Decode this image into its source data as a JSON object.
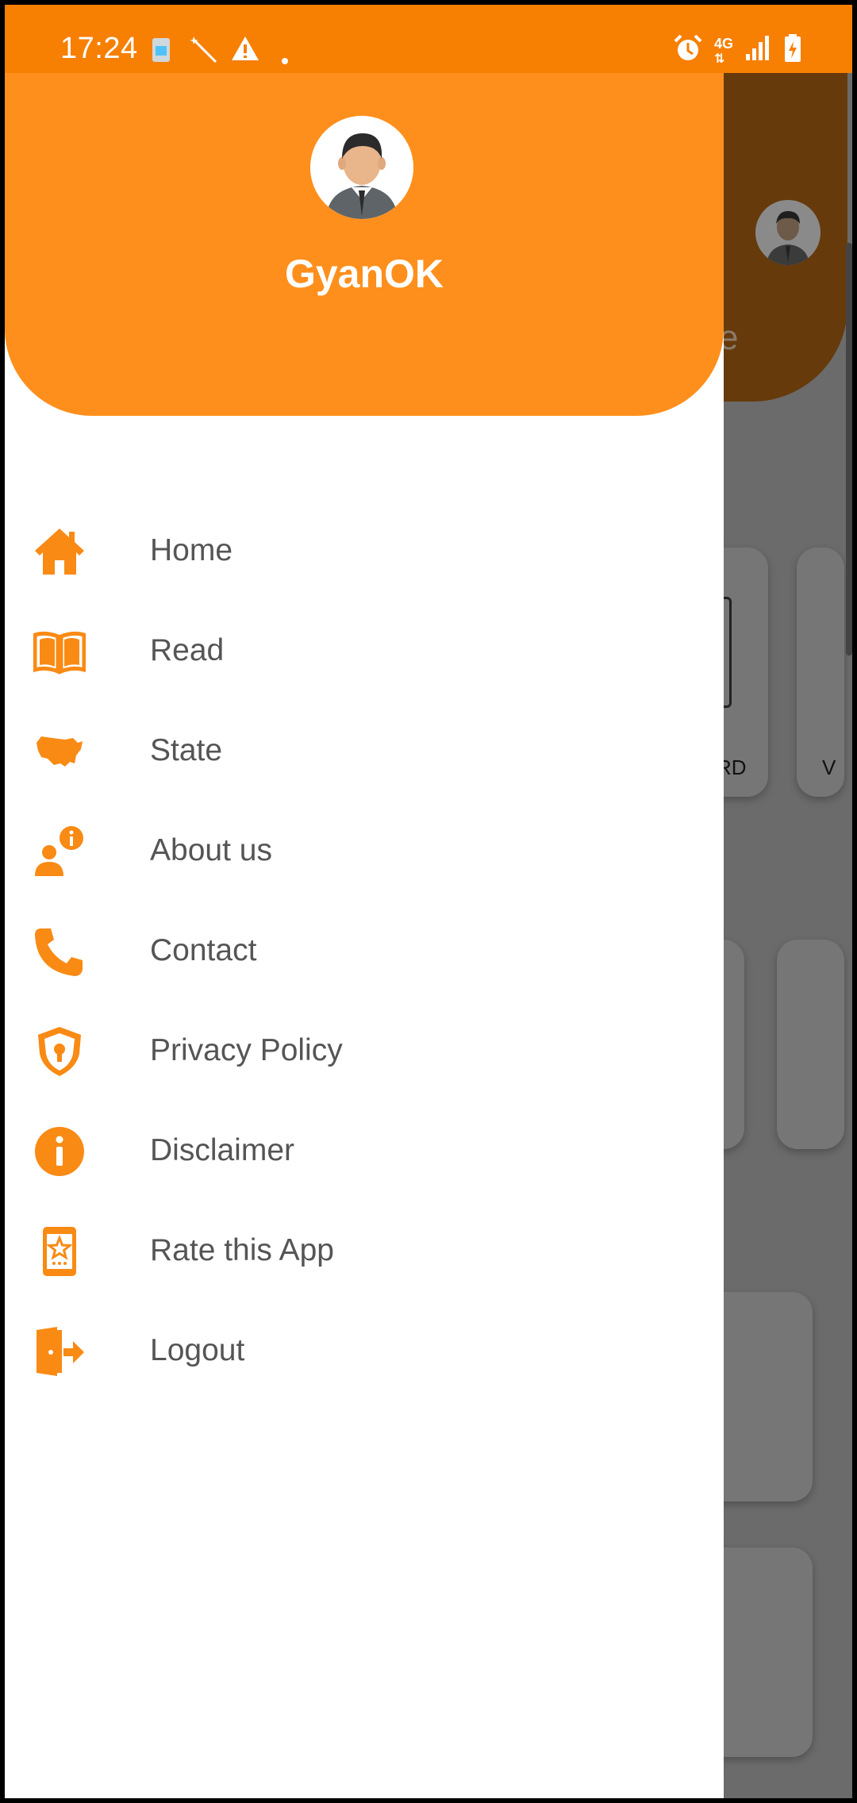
{
  "status_bar": {
    "time": "17:24",
    "left_icons": [
      "sim-card-icon",
      "magic-wand-icon",
      "warning-icon",
      "dot-icon"
    ],
    "right_icons": [
      "alarm-icon",
      "4g-icon",
      "signal-icon",
      "battery-icon"
    ],
    "network_label": "4G"
  },
  "drawer": {
    "user_name": "GyanOK",
    "menu": [
      {
        "label": "Home",
        "icon": "home-icon"
      },
      {
        "label": "Read",
        "icon": "book-icon"
      },
      {
        "label": "State",
        "icon": "map-icon"
      },
      {
        "label": "About us",
        "icon": "user-info-icon"
      },
      {
        "label": "Contact",
        "icon": "phone-icon"
      },
      {
        "label": "Privacy Policy",
        "icon": "shield-lock-icon"
      },
      {
        "label": "Disclaimer",
        "icon": "info-icon"
      },
      {
        "label": "Rate this App",
        "icon": "mobile-star-icon"
      },
      {
        "label": "Logout",
        "icon": "logout-icon"
      }
    ]
  },
  "background": {
    "header_letter": "e",
    "card_text_1": "RD",
    "card_text_2": "V"
  },
  "colors": {
    "accent": "#ff8f1c",
    "status_bar": "#f77f02",
    "icon": "#f98a14",
    "label": "#555555"
  }
}
